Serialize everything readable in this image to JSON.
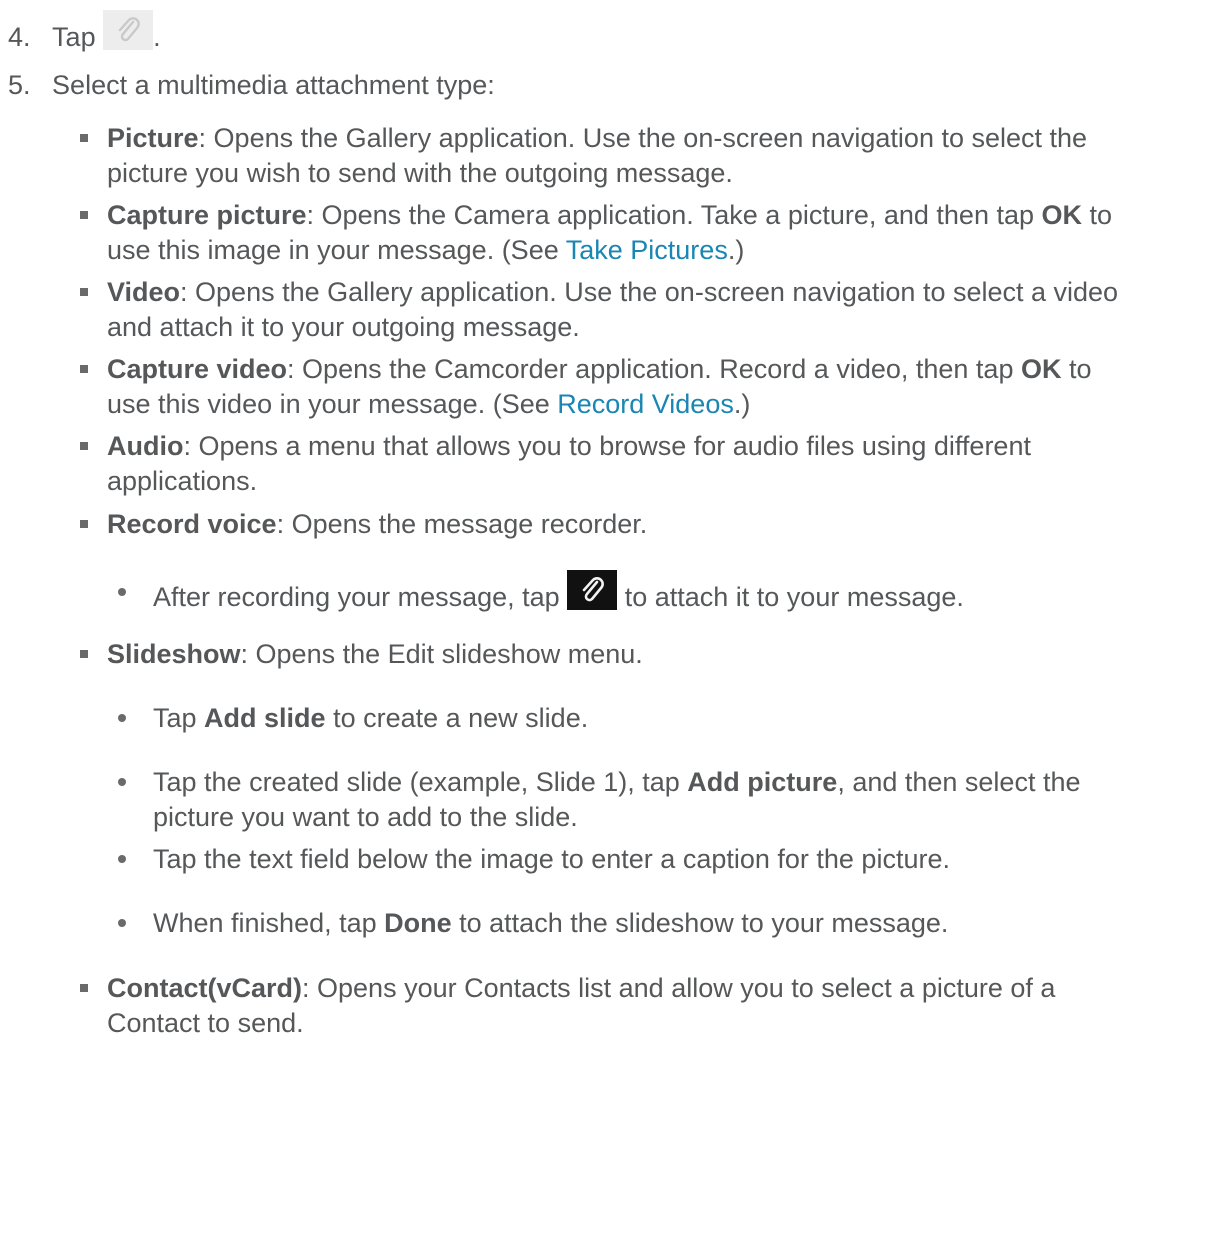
{
  "steps": [
    {
      "number": "4.",
      "pre": "Tap",
      "post": ".",
      "icon": "paperclip-icon"
    },
    {
      "number": "5.",
      "text": "Select a multimedia attachment type:"
    }
  ],
  "items": {
    "picture": {
      "term": "Picture",
      "line1": ": Opens the Gallery application. Use the on-screen navigation to select the",
      "line2": "picture you wish to send with the outgoing message."
    },
    "capture_picture": {
      "term": "Capture picture",
      "line1a": ": Opens the Camera application. Take a picture, and then tap ",
      "ok": "OK",
      "line1b": " to",
      "line2a": "use this image in your message. (See ",
      "link": "Take Pictures",
      "line2b": ".)"
    },
    "video": {
      "term": "Video",
      "line1": ": Opens the Gallery application. Use the on-screen navigation to select a video",
      "line2": "and attach it to your outgoing message."
    },
    "capture_video": {
      "term": "Capture video",
      "line1a": ": Opens the Camcorder application. Record a video, then tap ",
      "ok": "OK",
      "line1b": " to",
      "line2a": "use this video in your message. (See ",
      "link": "Record Videos",
      "line2b": ".)"
    },
    "audio": {
      "term": "Audio",
      "line1": ": Opens a menu that allows you to browse for audio files using different",
      "line2": "applications."
    },
    "record_voice": {
      "term": "Record voice",
      "line1": ": Opens the message recorder.",
      "sub1a": "After recording your message, tap ",
      "sub1b": " to attach it to your message.",
      "icon": "paperclip-icon"
    },
    "slideshow": {
      "term": "Slideshow",
      "line1": ": Opens the Edit slideshow menu.",
      "s1a": "Tap ",
      "s1b": "Add slide",
      "s1c": " to create a new slide.",
      "s2a": "Tap the created slide (example, Slide 1), tap ",
      "s2b": "Add picture",
      "s2c": ", and then select the",
      "s2line2": "picture you want to add to the slide.",
      "s3": "Tap the text field below the image to enter a caption for the picture.",
      "s4a": "When finished, tap ",
      "s4b": "Done",
      "s4c": " to attach the slideshow to your message."
    },
    "contact": {
      "term": "Contact(vCard)",
      "line1": ": Opens your Contacts list and allow you to select a picture of a",
      "line2": "Contact to send."
    }
  },
  "colors": {
    "text": "#555759",
    "link": "#1a86b4",
    "bullet": "#6a6a6a"
  }
}
